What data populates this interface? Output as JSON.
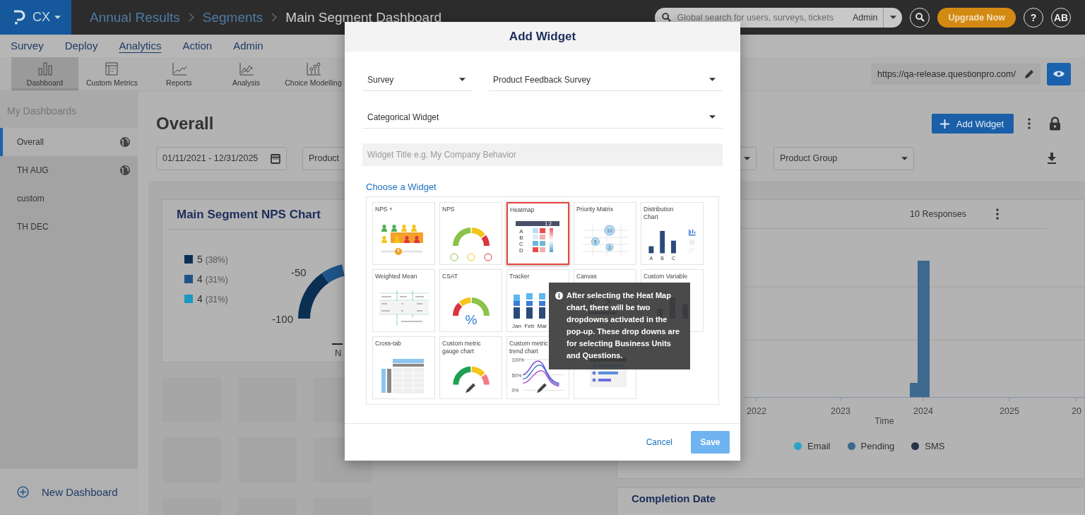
{
  "topbar": {
    "product": "CX",
    "breadcrumb": [
      {
        "label": "Annual Results",
        "current": false
      },
      {
        "label": "Segments",
        "current": false
      },
      {
        "label": "Main Segment Dashboard",
        "current": true
      }
    ],
    "search": {
      "placeholder": "Global search for users, surveys, tickets",
      "scope": "Admin"
    },
    "upgrade": "Upgrade Now",
    "help": "?",
    "avatar": "AB"
  },
  "menu": [
    {
      "label": "Survey",
      "selected": false
    },
    {
      "label": "Deploy",
      "selected": false
    },
    {
      "label": "Analytics",
      "selected": true
    },
    {
      "label": "Action",
      "selected": false
    },
    {
      "label": "Admin",
      "selected": false
    }
  ],
  "toolbar": {
    "items": [
      {
        "label": "Dashboard",
        "selected": true
      },
      {
        "label": "Custom Metrics",
        "selected": false
      },
      {
        "label": "Reports",
        "selected": false
      },
      {
        "label": "Analysis",
        "selected": false
      },
      {
        "label": "Choice Modelling",
        "selected": false
      }
    ],
    "url": "https://qa-release.questionpro.com/"
  },
  "sidebar": {
    "heading": "My Dashboards",
    "items": [
      {
        "label": "Overall",
        "selected": true,
        "shared": true
      },
      {
        "label": "TH AUG",
        "selected": false,
        "shared": true
      },
      {
        "label": "custom",
        "selected": false,
        "shared": false
      },
      {
        "label": "TH DEC",
        "selected": false,
        "shared": false
      }
    ],
    "new_button": "New Dashboard"
  },
  "dashboard": {
    "title": "Overall",
    "add_button": "Add Widget",
    "filters": [
      {
        "kind": "date",
        "value": "01/11/2021 - 12/31/2025"
      },
      {
        "kind": "select",
        "value": "Product"
      },
      {
        "kind": "select"
      },
      {
        "kind": "select",
        "value": "Product Group"
      }
    ],
    "nps_card": {
      "title": "Main Segment NPS Chart",
      "legend": [
        {
          "value": "5",
          "share": "(38%)",
          "color": "#0b2f52"
        },
        {
          "value": "4",
          "share": "(31%)",
          "color": "#1f5488"
        },
        {
          "value": "4",
          "share": "(31%)",
          "color": "#1899c2"
        }
      ],
      "gauge_labels": [
        "-50",
        "-100"
      ],
      "axis_label": "N"
    },
    "responses_card": {
      "count": "10 Responses",
      "x_labels": [
        "2022",
        "2023",
        "2024",
        "2025",
        "20"
      ],
      "x_title": "Time",
      "legend": [
        {
          "label": "Email",
          "color": "#2aa3c6"
        },
        {
          "label": "Pending",
          "color": "#3d6a8e"
        },
        {
          "label": "SMS",
          "color": "#283248"
        }
      ]
    },
    "next_card": {
      "title": "Completion Date"
    }
  },
  "modal": {
    "title": "Add Widget",
    "fields": [
      {
        "kind": "select",
        "value": "Survey"
      },
      {
        "kind": "select",
        "value": "Product Feedback Survey"
      },
      {
        "kind": "select",
        "value": "Categorical Widget"
      },
      {
        "kind": "input",
        "placeholder": "Widget Title e.g. My Company Behavior"
      }
    ],
    "section_title": "Choose a Widget",
    "widgets": [
      {
        "title": "NPS +",
        "kind": "npsplus",
        "selected": false
      },
      {
        "title": "NPS",
        "kind": "nps",
        "selected": false
      },
      {
        "title": "Heatmap",
        "kind": "heatmap",
        "selected": true,
        "labels": [
          "1 2",
          "A",
          "B",
          "C",
          "D"
        ]
      },
      {
        "title": "Priority Matrix",
        "kind": "matrix",
        "selected": false,
        "labels": [
          "10",
          "5",
          "3"
        ]
      },
      {
        "title": "Distribution Chart",
        "kind": "distribution",
        "selected": false,
        "labels": [
          "A",
          "B",
          "C"
        ]
      },
      {
        "title": "Weighted Mean",
        "kind": "weighted",
        "selected": false
      },
      {
        "title": "CSAT",
        "kind": "csat",
        "selected": false,
        "labels": [
          "%"
        ]
      },
      {
        "title": "Tracker",
        "kind": "tracker",
        "selected": false,
        "labels": [
          "Jan",
          "Feb",
          "Mar"
        ]
      },
      {
        "title": "Canvas",
        "kind": "canvas",
        "selected": false
      },
      {
        "title": "Custom Variable",
        "kind": "variable",
        "selected": false
      },
      {
        "title": "Cross-tab",
        "kind": "crosstab",
        "selected": false
      },
      {
        "title": "Custom metric gauge chart",
        "kind": "gauge",
        "selected": false
      },
      {
        "title": "Custom metric trend chart",
        "kind": "trend",
        "selected": false,
        "labels": [
          "100%",
          "50%",
          "0%"
        ]
      },
      {
        "kind": "ranking",
        "selected": false
      }
    ],
    "tooltip": "After selecting the Heat Map chart, there will be two dropdowns activated in the pop-up. These drop downs are for selecting Business Units and Questions.",
    "cancel": "Cancel",
    "save": "Save"
  }
}
